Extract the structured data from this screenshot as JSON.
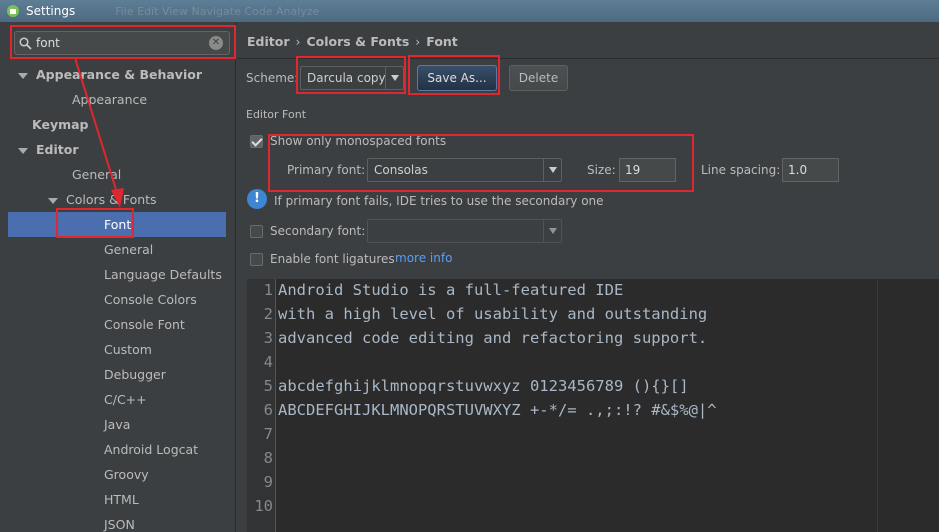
{
  "window": {
    "title": "Settings",
    "ghost_menu": "File   Edit   View   Navigate   Code   Analyze"
  },
  "search": {
    "value": "font"
  },
  "sidebar": {
    "items": [
      {
        "label": "Appearance & Behavior",
        "level": 0,
        "bold": true,
        "expanded": true
      },
      {
        "label": "Appearance",
        "level": 1
      },
      {
        "label": "Keymap",
        "level": 0,
        "bold": true
      },
      {
        "label": "Editor",
        "level": 0,
        "bold": true,
        "expanded": true
      },
      {
        "label": "General",
        "level": 1
      },
      {
        "label": "Colors & Fonts",
        "level": 1,
        "expanded": true
      },
      {
        "label": "Font",
        "level": 2,
        "selected": true
      },
      {
        "label": "General",
        "level": 2
      },
      {
        "label": "Language Defaults",
        "level": 2
      },
      {
        "label": "Console Colors",
        "level": 2
      },
      {
        "label": "Console Font",
        "level": 2
      },
      {
        "label": "Custom",
        "level": 2
      },
      {
        "label": "Debugger",
        "level": 2
      },
      {
        "label": "C/C++",
        "level": 2
      },
      {
        "label": "Java",
        "level": 2
      },
      {
        "label": "Android Logcat",
        "level": 2
      },
      {
        "label": "Groovy",
        "level": 2
      },
      {
        "label": "HTML",
        "level": 2
      },
      {
        "label": "JSON",
        "level": 2
      }
    ]
  },
  "breadcrumb": {
    "parts": [
      "Editor",
      "Colors & Fonts",
      "Font"
    ]
  },
  "scheme": {
    "label": "Scheme:",
    "value": "Darcula copy",
    "save_as": "Save As...",
    "delete": "Delete"
  },
  "editor_font": {
    "section_title": "Editor Font",
    "monospaced_label": "Show only monospaced fonts",
    "monospaced_checked": true,
    "primary_label": "Primary font:",
    "primary_value": "Consolas",
    "size_label": "Size:",
    "size_value": "19",
    "spacing_label": "Line spacing:",
    "spacing_value": "1.0",
    "info_text": "If primary font fails, IDE tries to use the secondary one",
    "secondary_label": "Secondary font:",
    "secondary_value": "",
    "ligatures_label": "Enable font ligatures",
    "ligatures_checked": false,
    "more_info": "more info"
  },
  "preview": {
    "lines": [
      "Android Studio is a full-featured IDE",
      "with a high level of usability and outstanding",
      "advanced code editing and refactoring support.",
      "",
      "abcdefghijklmnopqrstuvwxyz 0123456789 (){}[]",
      "ABCDEFGHIJKLMNOPQRSTUVWXYZ +-*/= .,;:!? #&$%@|^",
      "",
      "",
      "",
      ""
    ]
  },
  "colors": {
    "accent": "#4b6eaf",
    "highlight": "#e0262e",
    "link": "#589df6"
  }
}
